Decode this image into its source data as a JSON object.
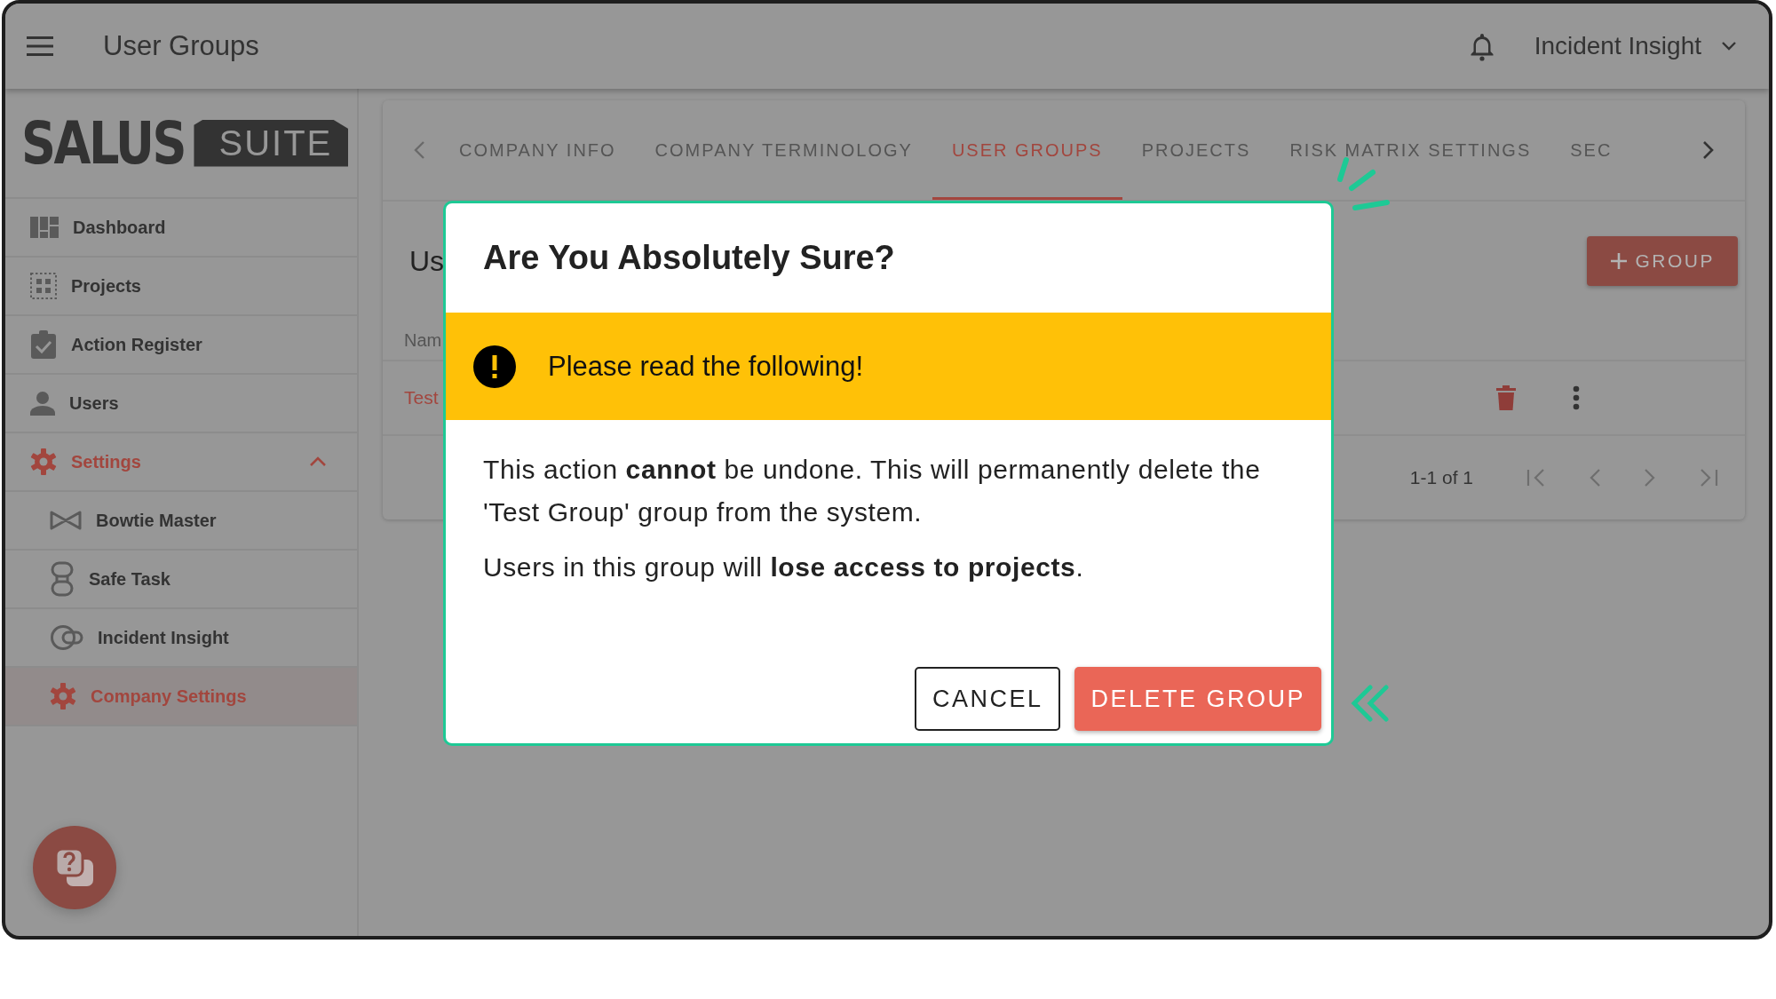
{
  "app_bar": {
    "title": "User Groups",
    "account": "Incident Insight"
  },
  "sidebar": {
    "logo": {
      "word": "SALUS",
      "badge": "SUITE"
    },
    "items": [
      {
        "label": "Dashboard",
        "selected": false
      },
      {
        "label": "Projects",
        "selected": false
      },
      {
        "label": "Action Register",
        "selected": false
      },
      {
        "label": "Users",
        "selected": false
      },
      {
        "label": "Settings",
        "selected": false,
        "expanded": true,
        "children": [
          {
            "label": "Bowtie Master",
            "selected": false
          },
          {
            "label": "Safe Task",
            "selected": false
          },
          {
            "label": "Incident Insight",
            "selected": false
          },
          {
            "label": "Company Settings",
            "selected": true
          }
        ]
      }
    ]
  },
  "tabs": [
    {
      "label": "COMPANY INFO",
      "selected": false
    },
    {
      "label": "COMPANY TERMINOLOGY",
      "selected": false
    },
    {
      "label": "USER GROUPS",
      "selected": true
    },
    {
      "label": "PROJECTS",
      "selected": false
    },
    {
      "label": "RISK MATRIX SETTINGS",
      "selected": false
    },
    {
      "label": "SEC",
      "selected": false
    }
  ],
  "page": {
    "heading": "Us",
    "add_button": "GROUP",
    "column_1": "Nam",
    "rows": [
      {
        "name": "Test"
      }
    ],
    "pagination": "1-1 of 1"
  },
  "dialog": {
    "title": "Are You Absolutely Sure?",
    "warning": "Please read the following!",
    "paragraphs": [
      "This action **cannot** be undone. This will permanently delete the 'Test Group' group from the system.",
      "Users in this group will **lose access to projects**."
    ],
    "buttons": [
      {
        "label": "CANCEL",
        "kind": "outlined"
      },
      {
        "label": "DELETE GROUP",
        "kind": "danger"
      }
    ]
  }
}
